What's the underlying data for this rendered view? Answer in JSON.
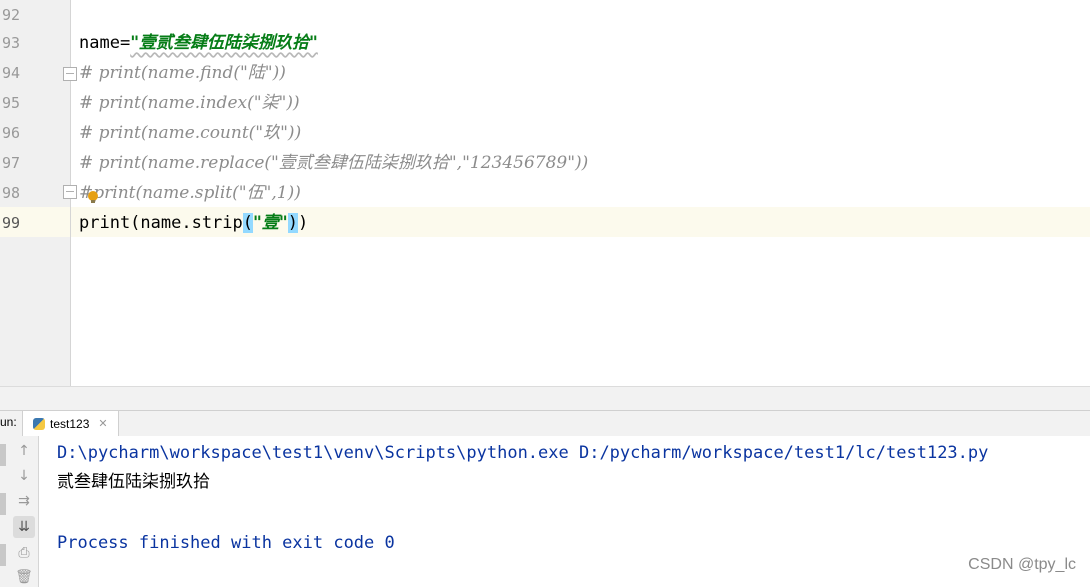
{
  "editor": {
    "line_numbers": [
      "92",
      "93",
      "94",
      "95",
      "96",
      "97",
      "98",
      "99"
    ],
    "lines": {
      "l93": {
        "var": "name=",
        "str": "\"壹贰叁肆伍陆柒捌玖拾\""
      },
      "l94": "# print(name.find(\"陆\"))",
      "l95": "# print(name.index(\"柒\"))",
      "l96": "# print(name.count(\"玖\"))",
      "l97": "# print(name.replace(\"壹贰叁肆伍陆柒捌玖拾\",\"123456789\"))",
      "l98": "#print(name.split(\"伍\",1))",
      "l99": {
        "pre": "print(name.strip",
        "open": "(",
        "str": "\"壹\"",
        "close": ")",
        "end": ")"
      }
    }
  },
  "run": {
    "label": "un:",
    "tab_label": "test123",
    "tab_close": "✕",
    "output": {
      "cmd": "D:\\pycharm\\workspace\\test1\\venv\\Scripts\\python.exe D:/pycharm/workspace/test1/lc/test123.py",
      "result": "贰叁肆伍陆柒捌玖拾",
      "exit": "Process finished with exit code 0"
    },
    "toolbar_icons": [
      "arrow-up-icon",
      "arrow-down-icon",
      "soft-wrap-icon",
      "scroll-to-end-icon",
      "print-icon",
      "trash-icon"
    ]
  },
  "watermark": "CSDN @tpy_lc"
}
